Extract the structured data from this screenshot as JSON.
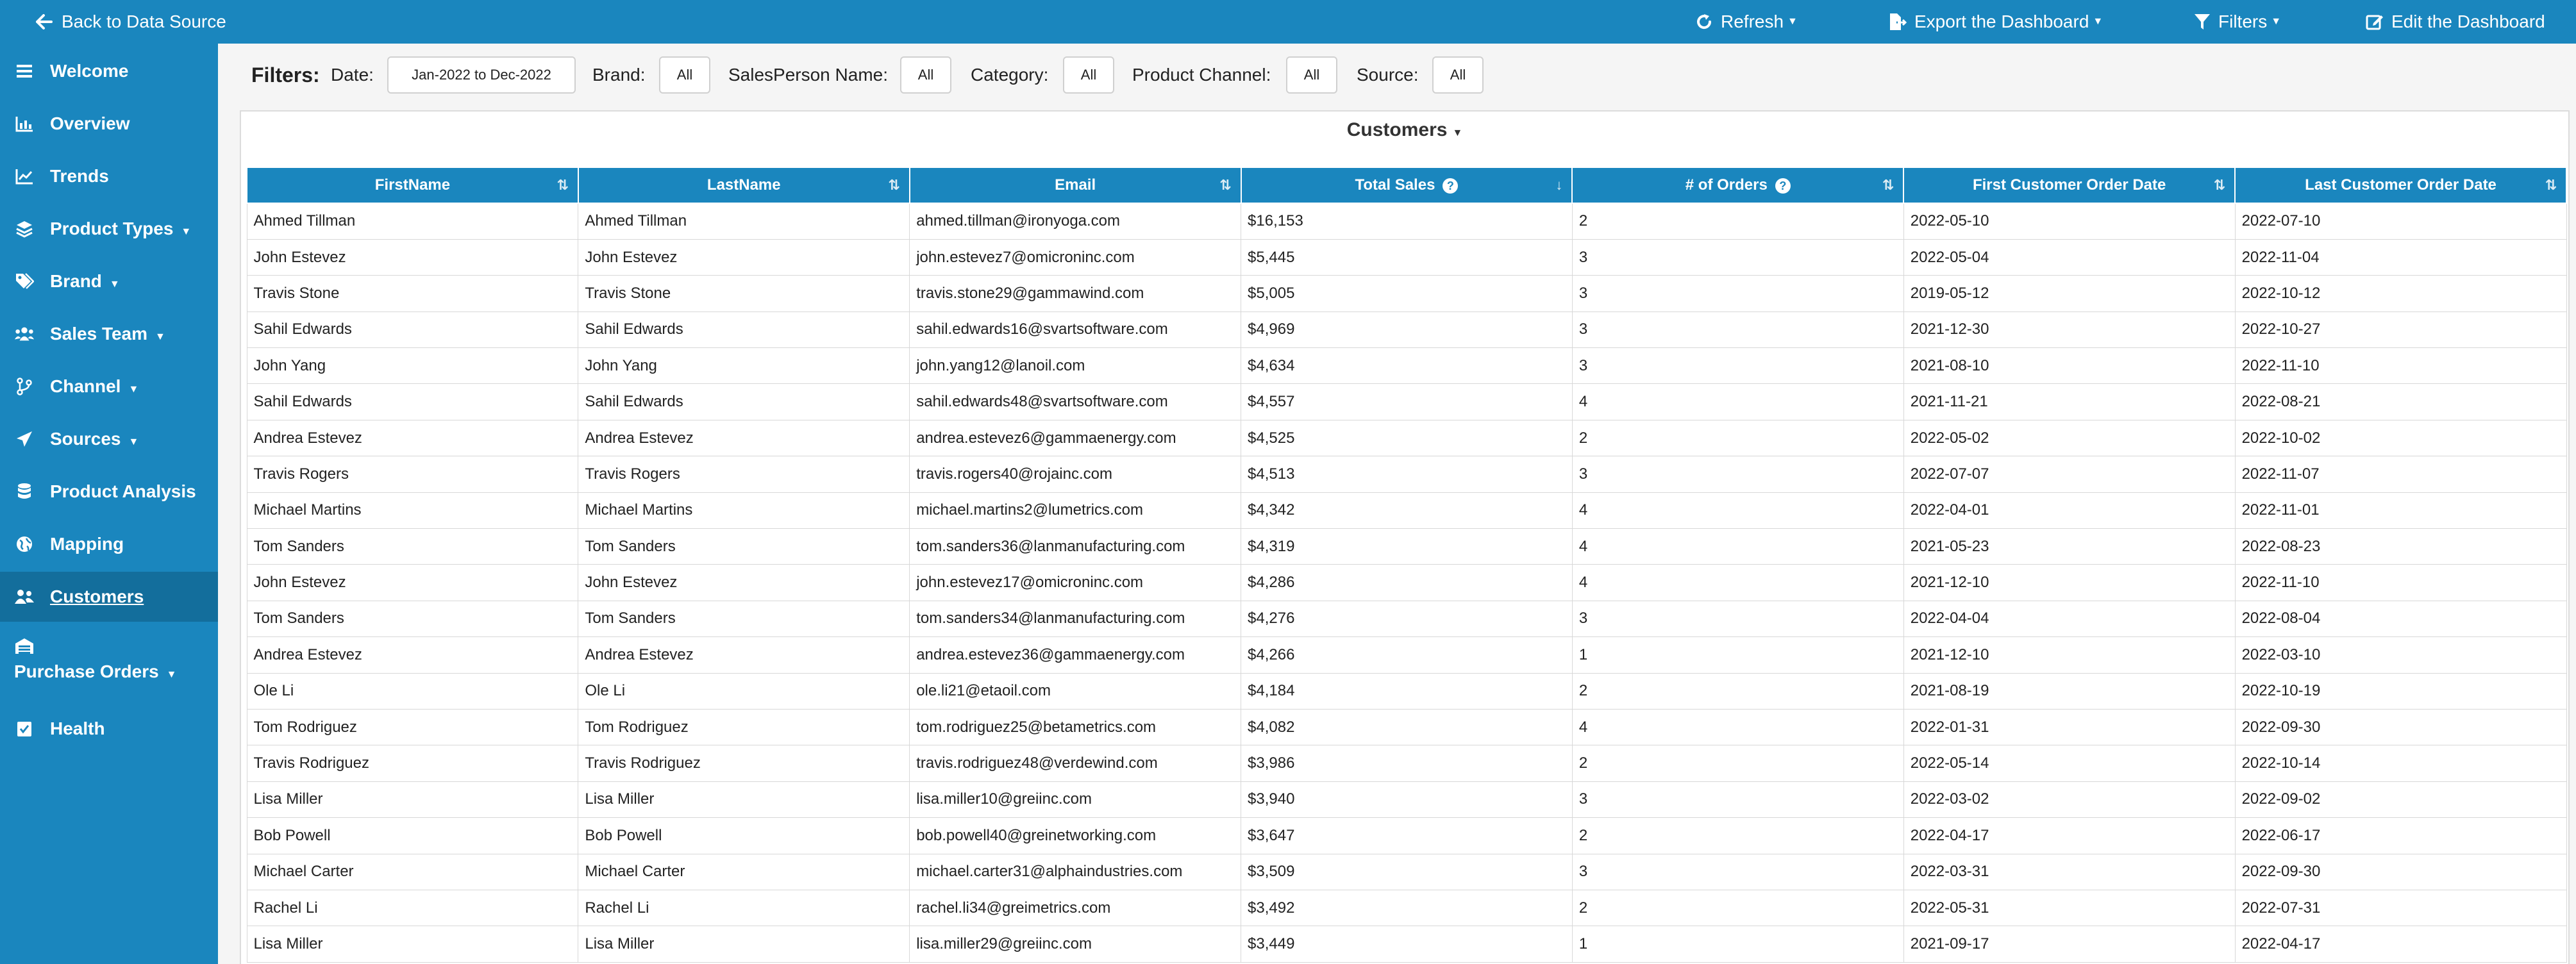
{
  "topbar": {
    "back_label": "Back to Data Source",
    "refresh_label": "Refresh",
    "export_label": "Export the Dashboard",
    "filters_label": "Filters",
    "edit_label": "Edit the Dashboard"
  },
  "sidebar": {
    "items": [
      {
        "label": "Welcome",
        "icon": "menu-icon",
        "caret": false
      },
      {
        "label": "Overview",
        "icon": "chart-bar-icon",
        "caret": false
      },
      {
        "label": "Trends",
        "icon": "chart-line-icon",
        "caret": false
      },
      {
        "label": "Product Types",
        "icon": "layers-icon",
        "caret": true
      },
      {
        "label": "Brand",
        "icon": "tags-icon",
        "caret": true
      },
      {
        "label": "Sales Team",
        "icon": "users-icon",
        "caret": true
      },
      {
        "label": "Channel",
        "icon": "branch-icon",
        "caret": true
      },
      {
        "label": "Sources",
        "icon": "send-icon",
        "caret": true
      },
      {
        "label": "Product Analysis",
        "icon": "database-icon",
        "caret": false
      },
      {
        "label": "Mapping",
        "icon": "globe-icon",
        "caret": false
      },
      {
        "label": "Customers",
        "icon": "users-icon",
        "caret": false,
        "active": true
      },
      {
        "label": "Purchase Orders",
        "icon": "warehouse-icon",
        "caret": true
      },
      {
        "label": "Health",
        "icon": "check-square-icon",
        "caret": false
      }
    ]
  },
  "filters": {
    "title": "Filters:",
    "date_label": "Date:",
    "date_value": "Jan-2022 to Dec-2022",
    "brand_label": "Brand:",
    "brand_value": "All",
    "salesperson_label": "SalesPerson Name:",
    "salesperson_value": "All",
    "category_label": "Category:",
    "category_value": "All",
    "channel_label": "Product Channel:",
    "channel_value": "All",
    "source_label": "Source:",
    "source_value": "All"
  },
  "panel": {
    "title": "Customers"
  },
  "table": {
    "columns": [
      "FirstName",
      "LastName",
      "Email",
      "Total Sales",
      "# of Orders",
      "First Customer Order Date",
      "Last Customer Order Date"
    ],
    "rows": [
      [
        "Ahmed Tillman",
        "Ahmed Tillman",
        "ahmed.tillman@ironyoga.com",
        "$16,153",
        "2",
        "2022-05-10",
        "2022-07-10"
      ],
      [
        "John Estevez",
        "John Estevez",
        "john.estevez7@omicroninc.com",
        "$5,445",
        "3",
        "2022-05-04",
        "2022-11-04"
      ],
      [
        "Travis Stone",
        "Travis Stone",
        "travis.stone29@gammawind.com",
        "$5,005",
        "3",
        "2019-05-12",
        "2022-10-12"
      ],
      [
        "Sahil Edwards",
        "Sahil Edwards",
        "sahil.edwards16@svartsoftware.com",
        "$4,969",
        "3",
        "2021-12-30",
        "2022-10-27"
      ],
      [
        "John Yang",
        "John Yang",
        "john.yang12@lanoil.com",
        "$4,634",
        "3",
        "2021-08-10",
        "2022-11-10"
      ],
      [
        "Sahil Edwards",
        "Sahil Edwards",
        "sahil.edwards48@svartsoftware.com",
        "$4,557",
        "4",
        "2021-11-21",
        "2022-08-21"
      ],
      [
        "Andrea Estevez",
        "Andrea Estevez",
        "andrea.estevez6@gammaenergy.com",
        "$4,525",
        "2",
        "2022-05-02",
        "2022-10-02"
      ],
      [
        "Travis Rogers",
        "Travis Rogers",
        "travis.rogers40@rojainc.com",
        "$4,513",
        "3",
        "2022-07-07",
        "2022-11-07"
      ],
      [
        "Michael Martins",
        "Michael Martins",
        "michael.martins2@lumetrics.com",
        "$4,342",
        "4",
        "2022-04-01",
        "2022-11-01"
      ],
      [
        "Tom Sanders",
        "Tom Sanders",
        "tom.sanders36@lanmanufacturing.com",
        "$4,319",
        "4",
        "2021-05-23",
        "2022-08-23"
      ],
      [
        "John Estevez",
        "John Estevez",
        "john.estevez17@omicroninc.com",
        "$4,286",
        "4",
        "2021-12-10",
        "2022-11-10"
      ],
      [
        "Tom Sanders",
        "Tom Sanders",
        "tom.sanders34@lanmanufacturing.com",
        "$4,276",
        "3",
        "2022-04-04",
        "2022-08-04"
      ],
      [
        "Andrea Estevez",
        "Andrea Estevez",
        "andrea.estevez36@gammaenergy.com",
        "$4,266",
        "1",
        "2021-12-10",
        "2022-03-10"
      ],
      [
        "Ole Li",
        "Ole Li",
        "ole.li21@etaoil.com",
        "$4,184",
        "2",
        "2021-08-19",
        "2022-10-19"
      ],
      [
        "Tom Rodriguez",
        "Tom Rodriguez",
        "tom.rodriguez25@betametrics.com",
        "$4,082",
        "4",
        "2022-01-31",
        "2022-09-30"
      ],
      [
        "Travis Rodriguez",
        "Travis Rodriguez",
        "travis.rodriguez48@verdewind.com",
        "$3,986",
        "2",
        "2022-05-14",
        "2022-10-14"
      ],
      [
        "Lisa Miller",
        "Lisa Miller",
        "lisa.miller10@greiinc.com",
        "$3,940",
        "3",
        "2022-03-02",
        "2022-09-02"
      ],
      [
        "Bob Powell",
        "Bob Powell",
        "bob.powell40@greinetworking.com",
        "$3,647",
        "2",
        "2022-04-17",
        "2022-06-17"
      ],
      [
        "Michael Carter",
        "Michael Carter",
        "michael.carter31@alphaindustries.com",
        "$3,509",
        "3",
        "2022-03-31",
        "2022-09-30"
      ],
      [
        "Rachel Li",
        "Rachel Li",
        "rachel.li34@greimetrics.com",
        "$3,492",
        "2",
        "2022-05-31",
        "2022-07-31"
      ],
      [
        "Lisa Miller",
        "Lisa Miller",
        "lisa.miller29@greiinc.com",
        "$3,449",
        "1",
        "2021-09-17",
        "2022-04-17"
      ]
    ]
  },
  "colors": {
    "primary": "#1a86be",
    "primary_dark": "#136e9c"
  }
}
